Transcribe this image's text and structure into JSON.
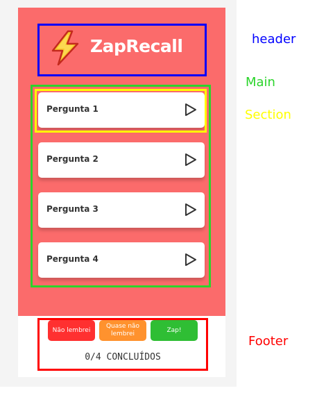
{
  "colors": {
    "background": "#f4f4f4",
    "main_bg": "#fb6b6b",
    "card_bg": "#ffffff",
    "header_outline": "#0000ff",
    "main_outline": "#2bd42b",
    "section_outline": "#ffff00",
    "footer_outline": "#ff0000",
    "btn_forgot": "#ff3030",
    "btn_almost": "#ff922e",
    "btn_zap": "#2fbe34"
  },
  "header": {
    "logo_icon": "lightning-bolt-icon",
    "title": "ZapRecall"
  },
  "questions": [
    {
      "label": "Pergunta 1",
      "icon": "play-icon"
    },
    {
      "label": "Pergunta 2",
      "icon": "play-icon"
    },
    {
      "label": "Pergunta 3",
      "icon": "play-icon"
    },
    {
      "label": "Pergunta 4",
      "icon": "play-icon"
    }
  ],
  "footer": {
    "buttons": [
      {
        "label": "Não lembrei"
      },
      {
        "label": "Quase não lembrei"
      },
      {
        "label": "Zap!"
      }
    ],
    "progress": "0/4 CONCLUÍDOS"
  },
  "annotations": {
    "header": "header",
    "main": "Main",
    "section": "Section",
    "footer": "Footer"
  }
}
